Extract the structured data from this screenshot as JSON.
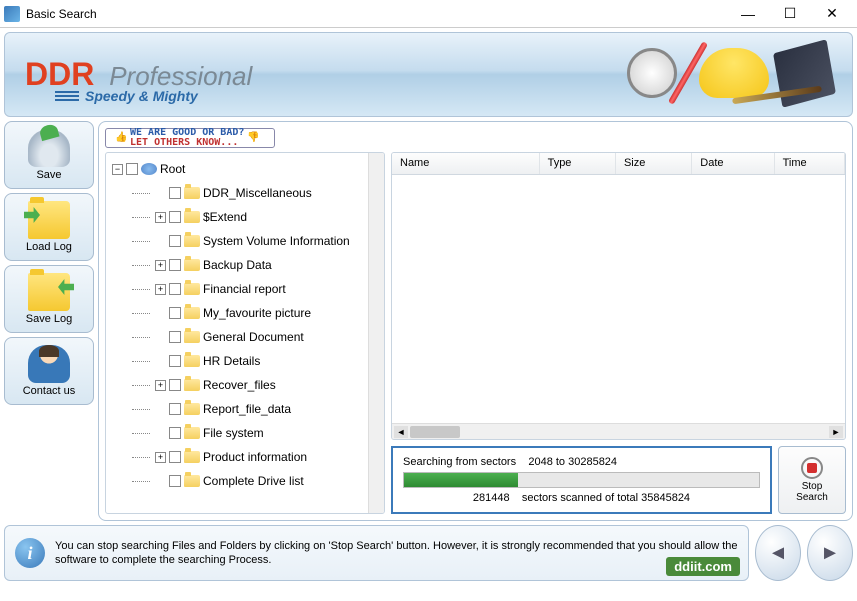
{
  "window": {
    "title": "Basic Search"
  },
  "header": {
    "brand1": "DDR",
    "brand2": "Professional",
    "tagline": "Speedy & Mighty"
  },
  "sidebar": {
    "save": "Save",
    "load_log": "Load Log",
    "save_log": "Save Log",
    "contact": "Contact us"
  },
  "banner": {
    "line1": "WE ARE GOOD OR BAD?",
    "line2": "LET OTHERS KNOW..."
  },
  "tree": {
    "root": "Root",
    "items": [
      {
        "label": "DDR_Miscellaneous",
        "expand": ""
      },
      {
        "label": "$Extend",
        "expand": "+"
      },
      {
        "label": "System Volume Information",
        "expand": ""
      },
      {
        "label": "Backup Data",
        "expand": "+"
      },
      {
        "label": "Financial report",
        "expand": "+"
      },
      {
        "label": "My_favourite picture",
        "expand": ""
      },
      {
        "label": "General Document",
        "expand": ""
      },
      {
        "label": "HR Details",
        "expand": ""
      },
      {
        "label": "Recover_files",
        "expand": "+"
      },
      {
        "label": "Report_file_data",
        "expand": ""
      },
      {
        "label": "File system",
        "expand": ""
      },
      {
        "label": "Product information",
        "expand": "+"
      },
      {
        "label": "Complete Drive list",
        "expand": ""
      }
    ]
  },
  "grid": {
    "cols": {
      "name": "Name",
      "type": "Type",
      "size": "Size",
      "date": "Date",
      "time": "Time"
    }
  },
  "progress": {
    "label": "Searching from sectors",
    "range": "2048 to 30285824",
    "scanned_prefix": "281448",
    "scanned_suffix": "sectors scanned of total 35845824",
    "percent": 32
  },
  "stop": {
    "line1": "Stop",
    "line2": "Search"
  },
  "hint": {
    "text": "You can stop searching Files and Folders by clicking on 'Stop Search' button. However, it is strongly recommended that you should allow the software to complete the searching Process.",
    "badge": "ddiit.com"
  }
}
